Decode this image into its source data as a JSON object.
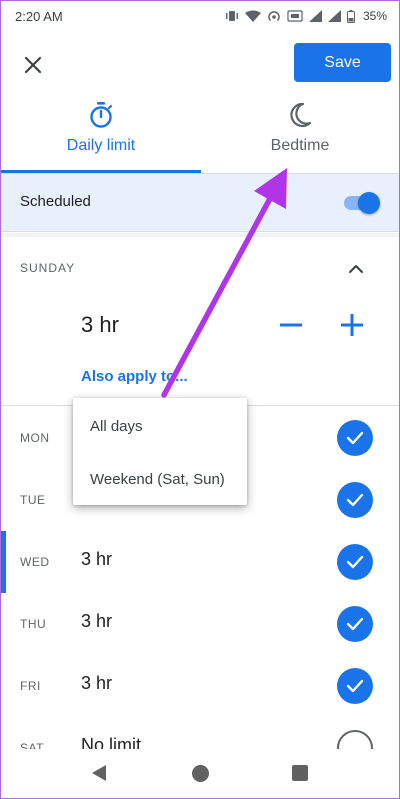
{
  "status_bar": {
    "time": "2:20 AM",
    "battery": "35%"
  },
  "toolbar": {
    "save_label": "Save"
  },
  "tabs": [
    {
      "label": "Daily limit",
      "selected": true
    },
    {
      "label": "Bedtime",
      "selected": false
    }
  ],
  "scheduled": {
    "label": "Scheduled",
    "enabled": true
  },
  "sunday": {
    "label": "SUNDAY",
    "value": "3 hr",
    "apply_link": "Also apply to..."
  },
  "popup_menu": {
    "items": [
      "All days",
      "Weekend (Sat, Sun)"
    ]
  },
  "days": [
    {
      "abbr": "MON",
      "value": "",
      "checked": true
    },
    {
      "abbr": "TUE",
      "value": "",
      "checked": true
    },
    {
      "abbr": "WED",
      "value": "3 hr",
      "checked": true
    },
    {
      "abbr": "THU",
      "value": "3 hr",
      "checked": true
    },
    {
      "abbr": "FRI",
      "value": "3 hr",
      "checked": true
    },
    {
      "abbr": "SAT",
      "value": "No limit",
      "checked": false
    }
  ],
  "colors": {
    "accent": "#1a73e8",
    "scheduled_bg": "#e8f0fe",
    "arrow": "#b035e8"
  }
}
